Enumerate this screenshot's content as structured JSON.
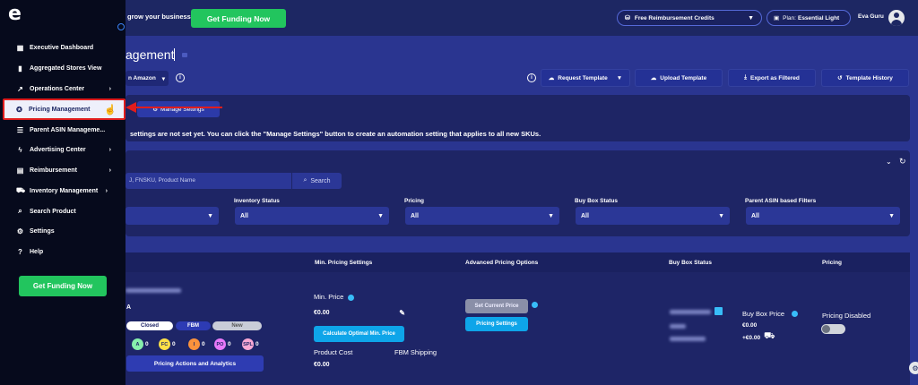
{
  "topbar": {
    "tagline": "grow your business!",
    "funding_label": "Get Funding Now",
    "credits_label": "Free Reimbursement Credits",
    "plan_prefix": "Plan:",
    "plan_name": "Essential Light",
    "user_name": "Eva Guru"
  },
  "page": {
    "title": "agement",
    "marketplace": "n Amazon",
    "toolbar": {
      "request_template": "Request Template",
      "upload_template": "Upload Template",
      "export_filtered": "Export as Filtered",
      "template_history": "Template History"
    }
  },
  "notice": {
    "manage_settings": "Manage Settings",
    "text": "settings are not set yet. You can click the \"Manage Settings\" button to create an automation setting that applies to all new SKUs."
  },
  "filters": {
    "search_placeholder": "J, FNSKU, Product Name",
    "search_label": "Search",
    "inventory_status_label": "Inventory Status",
    "pricing_label": "Pricing",
    "buybox_status_label": "Buy Box Status",
    "parent_asin_label": "Parent ASIN based Filters",
    "all": "All"
  },
  "table": {
    "headers": {
      "min_pricing": "Min. Pricing Settings",
      "advanced_pricing": "Advanced Pricing Options",
      "buy_box_status": "Buy Box Status",
      "pricing": "Pricing"
    },
    "row": {
      "a_label": "A",
      "closed": "Closed",
      "fbm": "FBM",
      "new": "New",
      "counters": [
        {
          "code": "A",
          "count": "0",
          "color": "#86efac"
        },
        {
          "code": "FC",
          "count": "0",
          "color": "#fde047"
        },
        {
          "code": "I",
          "count": "0",
          "color": "#fb923c"
        },
        {
          "code": "PO",
          "count": "0",
          "color": "#e879f9"
        },
        {
          "code": "SPL",
          "count": "0",
          "color": "#f9a8d4"
        }
      ],
      "actions_label": "Pricing Actions and Analytics",
      "min_price_label": "Min. Price",
      "min_price_value": "€0.00",
      "calc_label": "Calculate Optimal Min. Price",
      "product_cost": "Product Cost",
      "fbm_shipping": "FBM Shipping",
      "product_cost_value": "€0.00",
      "set_current": "Set Current Price",
      "pricing_settings": "Pricing Settings",
      "buy_box_price_label": "Buy Box Price",
      "buy_box_price": "€0.00",
      "buy_box_shipping": "+€0.00",
      "pricing_status": "Pricing Disabled"
    }
  },
  "sidebar": {
    "items": [
      {
        "label": "Executive Dashboard",
        "icon": "dashboard-icon"
      },
      {
        "label": "Aggregated Stores View",
        "icon": "bar-chart-icon"
      },
      {
        "label": "Operations Center",
        "icon": "trend-icon"
      },
      {
        "label": "Pricing Management",
        "icon": "award-icon"
      },
      {
        "label": "Parent ASIN Manageme...",
        "icon": "list-icon"
      },
      {
        "label": "Advertising Center",
        "icon": "bolt-icon"
      },
      {
        "label": "Reimbursement",
        "icon": "document-icon"
      },
      {
        "label": "Inventory Management",
        "icon": "truck-icon"
      },
      {
        "label": "Search Product",
        "icon": "search-icon"
      },
      {
        "label": "Settings",
        "icon": "gear-icon"
      },
      {
        "label": "Help",
        "icon": "help-icon"
      }
    ],
    "funding_label": "Get Funding Now"
  }
}
